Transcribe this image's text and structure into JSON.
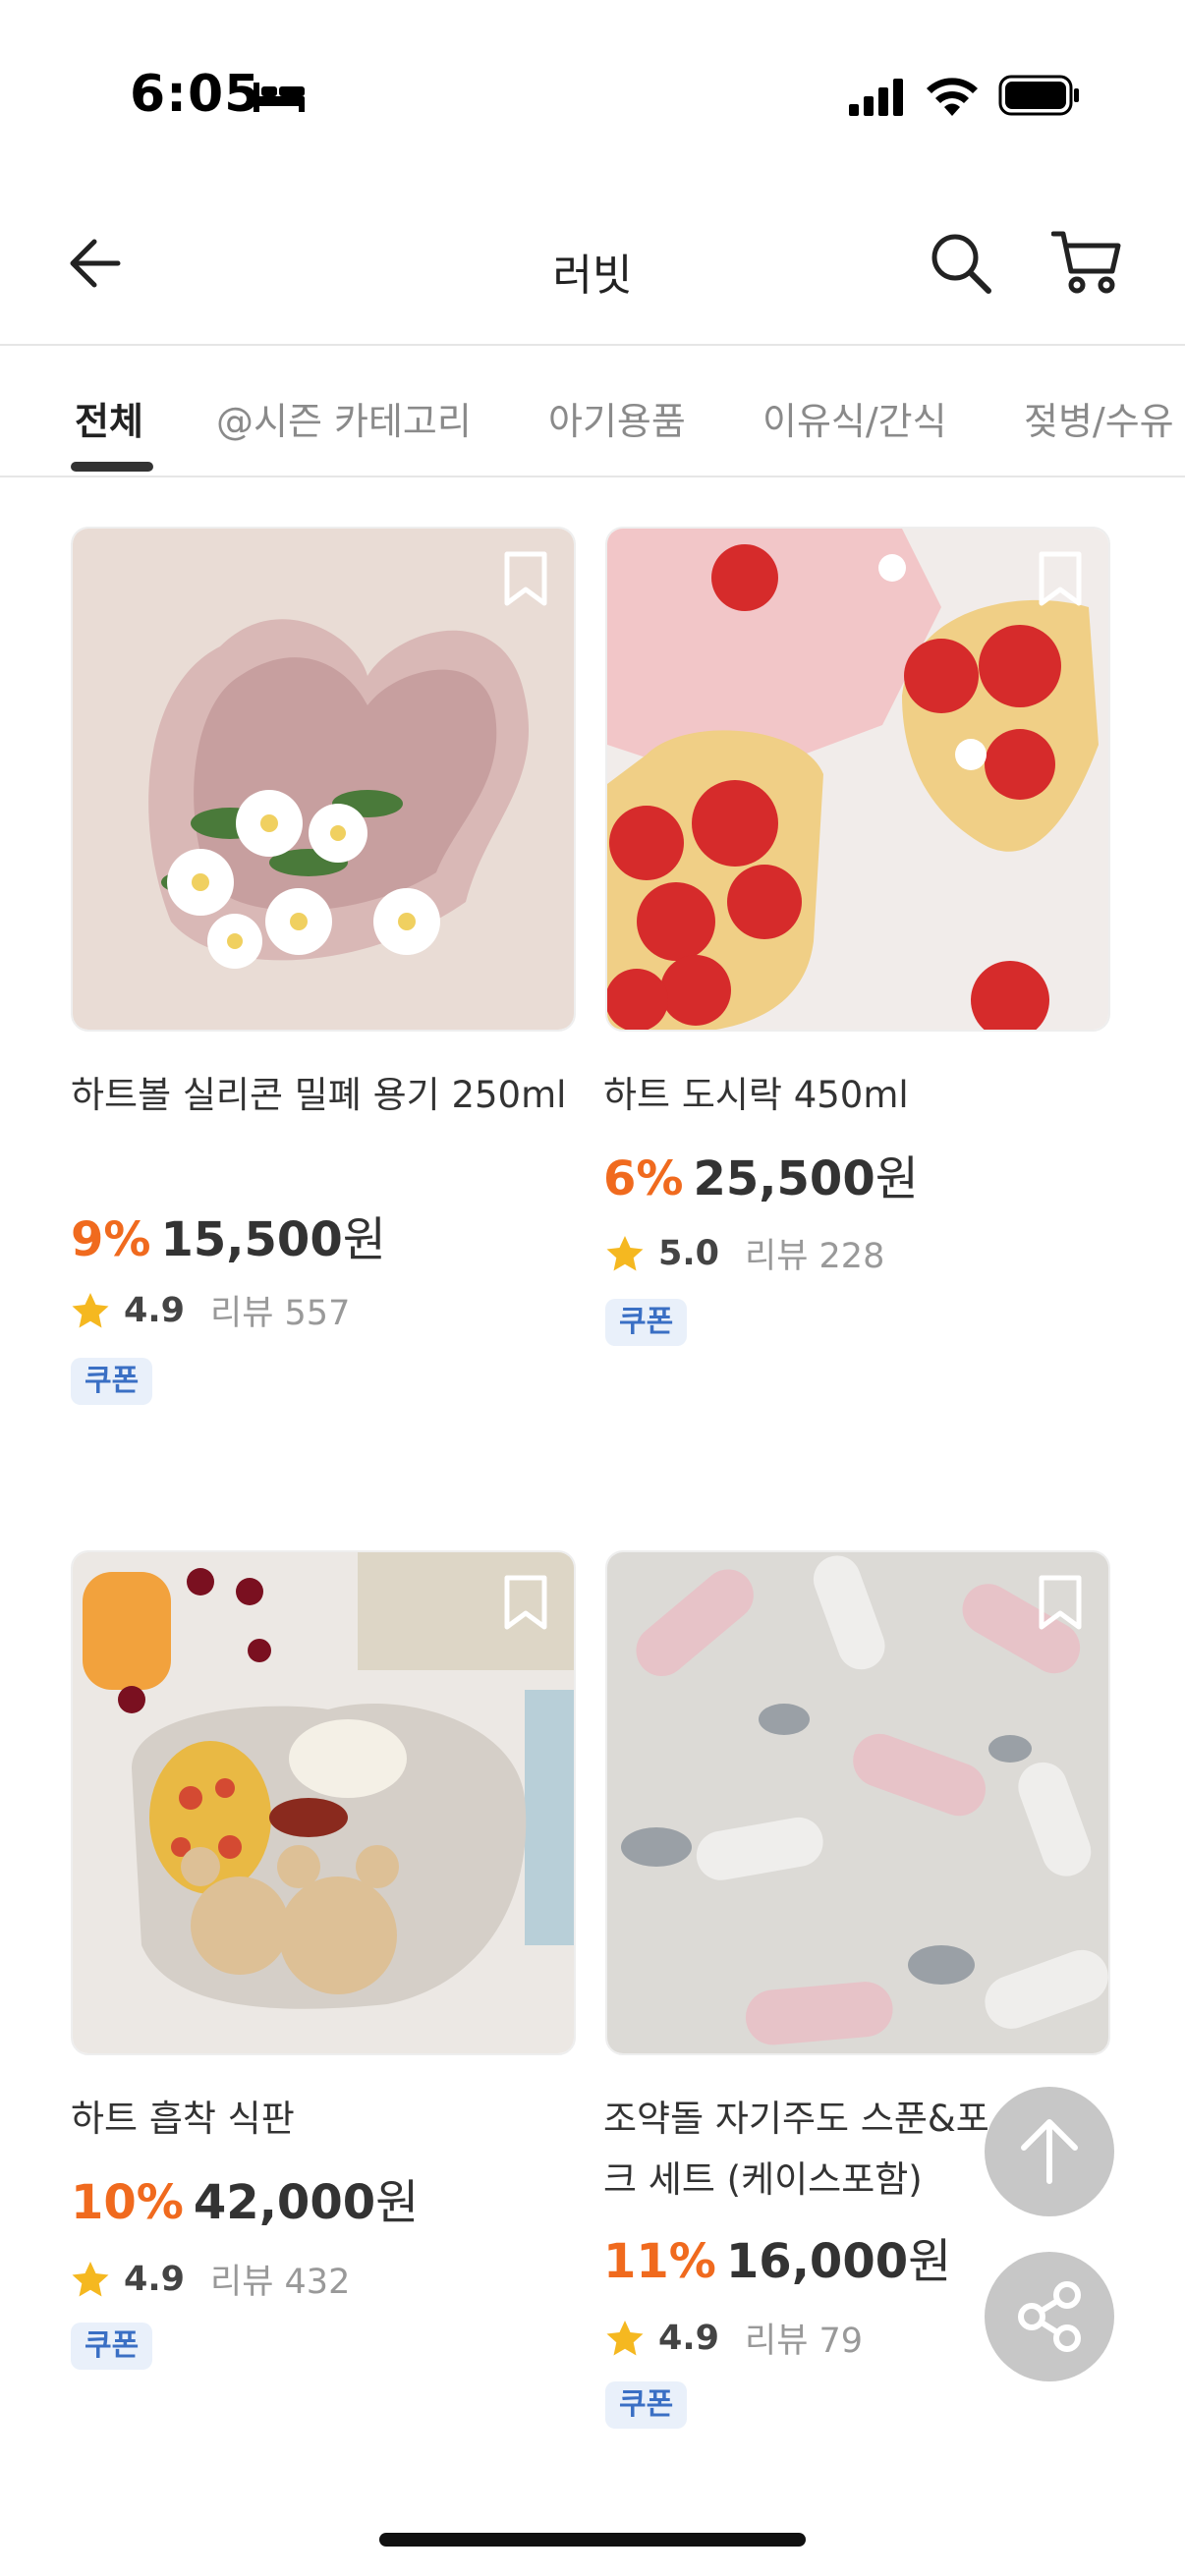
{
  "status_bar": {
    "time": "6:05"
  },
  "header": {
    "title": "러빗"
  },
  "tabs": [
    "전체",
    "@시즌 카테고리",
    "아기용품",
    "이유식/간식",
    "젖병/수유"
  ],
  "active_tab": 0,
  "products": [
    {
      "name": "하트볼 실리콘 밀폐 용기 250ml",
      "discount": "9%",
      "price": "15,500",
      "currency": "원",
      "rating": "4.9",
      "reviews": "리뷰 557",
      "badge": "쿠폰"
    },
    {
      "name": "하트 도시락 450ml",
      "discount": "6%",
      "price": "25,500",
      "currency": "원",
      "rating": "5.0",
      "reviews": "리뷰 228",
      "badge": "쿠폰"
    },
    {
      "name": "하트 흡착 식판",
      "discount": "10%",
      "price": "42,000",
      "currency": "원",
      "rating": "4.9",
      "reviews": "리뷰 432",
      "badge": "쿠폰"
    },
    {
      "name": "조약돌 자기주도 스푼&포크 세트 (케이스포함)",
      "discount": "11%",
      "price": "16,000",
      "currency": "원",
      "rating": "4.9",
      "reviews": "리뷰 79",
      "badge": "쿠폰"
    }
  ],
  "icons": {
    "back": "arrow-left-icon",
    "search": "search-icon",
    "cart": "cart-icon",
    "bookmark": "bookmark-icon",
    "star": "star-icon",
    "scroll_top": "arrow-up-icon",
    "share": "share-icon"
  },
  "colors": {
    "discount": "#f06a1e",
    "coupon_text": "#3a6fc4",
    "coupon_bg": "#e9f0fa",
    "star": "#f5b820",
    "fab": "#c7c7c7"
  }
}
